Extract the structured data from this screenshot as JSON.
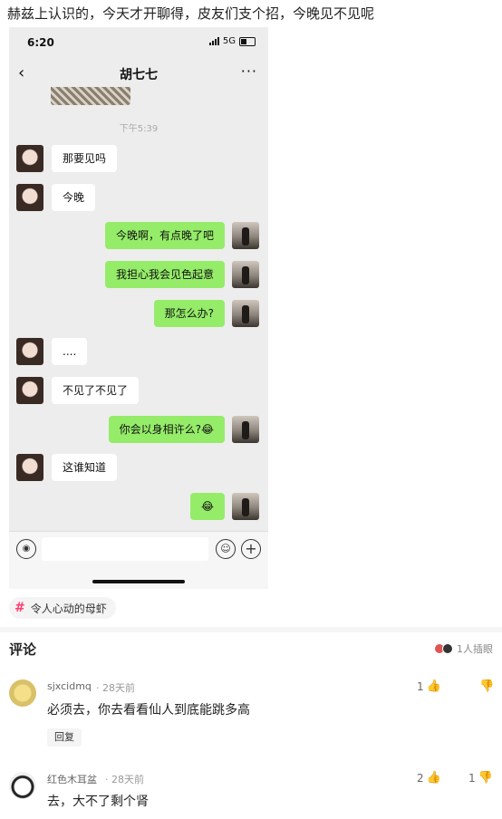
{
  "post": {
    "title": "赫兹上认识的，今天才开聊得，皮友们支个招，今晚见不见呢",
    "topic_tag": "令人心动的母虾",
    "topic_tag_icon": "hash-icon"
  },
  "phone": {
    "status_time": "6:20",
    "network": "5G",
    "chat_title": "胡七七",
    "more_label": "···",
    "back_label": "‹",
    "timestamp": "下午5:39",
    "messages": [
      {
        "side": "left",
        "text": "那要见吗"
      },
      {
        "side": "left",
        "text": "今晚"
      },
      {
        "side": "right",
        "text": "今晚啊，有点晚了吧"
      },
      {
        "side": "right",
        "text": "我担心我会见色起意"
      },
      {
        "side": "right",
        "text": "那怎么办?"
      },
      {
        "side": "left",
        "text": "...."
      },
      {
        "side": "left",
        "text": "不见了不见了"
      },
      {
        "side": "right",
        "text": "你会以身相许么?😂"
      },
      {
        "side": "left",
        "text": "这谁知道"
      },
      {
        "side": "right",
        "text": "😂"
      }
    ],
    "colors": {
      "sent_bubble": "#95ec69",
      "received_bubble": "#ffffff",
      "chat_bg": "#ededed"
    }
  },
  "comments": {
    "header": "评论",
    "participants_text": "1人插眼",
    "items": [
      {
        "user": "sjxcidmq",
        "time": "· 28天前",
        "text": "必须去，你去看看仙人到底能跳多高",
        "likes": "1",
        "dislikes": "",
        "reply_label": "回复"
      },
      {
        "user": "红色木耳盆",
        "time": "· 28天前",
        "text": "去，大不了剩个肾",
        "likes": "2",
        "dislikes": "1"
      }
    ]
  }
}
